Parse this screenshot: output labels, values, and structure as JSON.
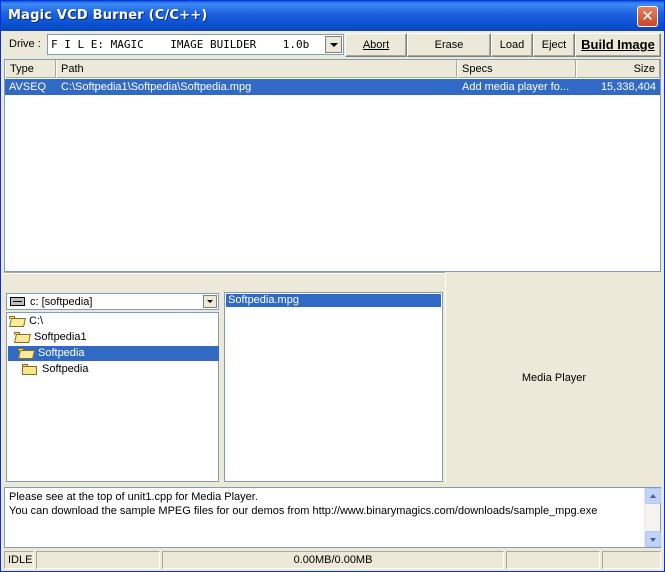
{
  "window": {
    "title": "Magic VCD Burner (C/C++)",
    "close_glyph": "✕"
  },
  "toolbar": {
    "drive_label": "Drive :",
    "drive_value": "F I L E: MAGIC    IMAGE BUILDER    1.0b",
    "abort_label": "Abort",
    "erase_label": "Erase",
    "load_label": "Load",
    "eject_label": "Eject",
    "build_label": "Build Image"
  },
  "track_list": {
    "columns": [
      "Type",
      "Path",
      "Specs",
      "Size"
    ],
    "rows": [
      {
        "type": "AVSEQ",
        "path": "C:\\Softpedia1\\Softpedia\\Softpedia.mpg",
        "specs": "Add media player fo...",
        "size": "15,338,404"
      }
    ]
  },
  "browser": {
    "drive": "c: [softpedia]",
    "tree": [
      {
        "label": "C:\\",
        "selected": false
      },
      {
        "label": "Softpedia1",
        "selected": false
      },
      {
        "label": "Softpedia",
        "selected": true
      },
      {
        "label": "Softpedia",
        "selected": false
      }
    ],
    "files": [
      "Softpedia.mpg"
    ]
  },
  "player": {
    "label": "Media Player"
  },
  "log": {
    "lines": [
      "Please see at the top of unit1.cpp for Media Player.",
      "You can download the sample MPEG files for our demos from http://www.binarymagics.com/downloads/sample_mpg.exe"
    ]
  },
  "status": {
    "state": "IDLE",
    "usage": "0.00MB/0.00MB"
  }
}
